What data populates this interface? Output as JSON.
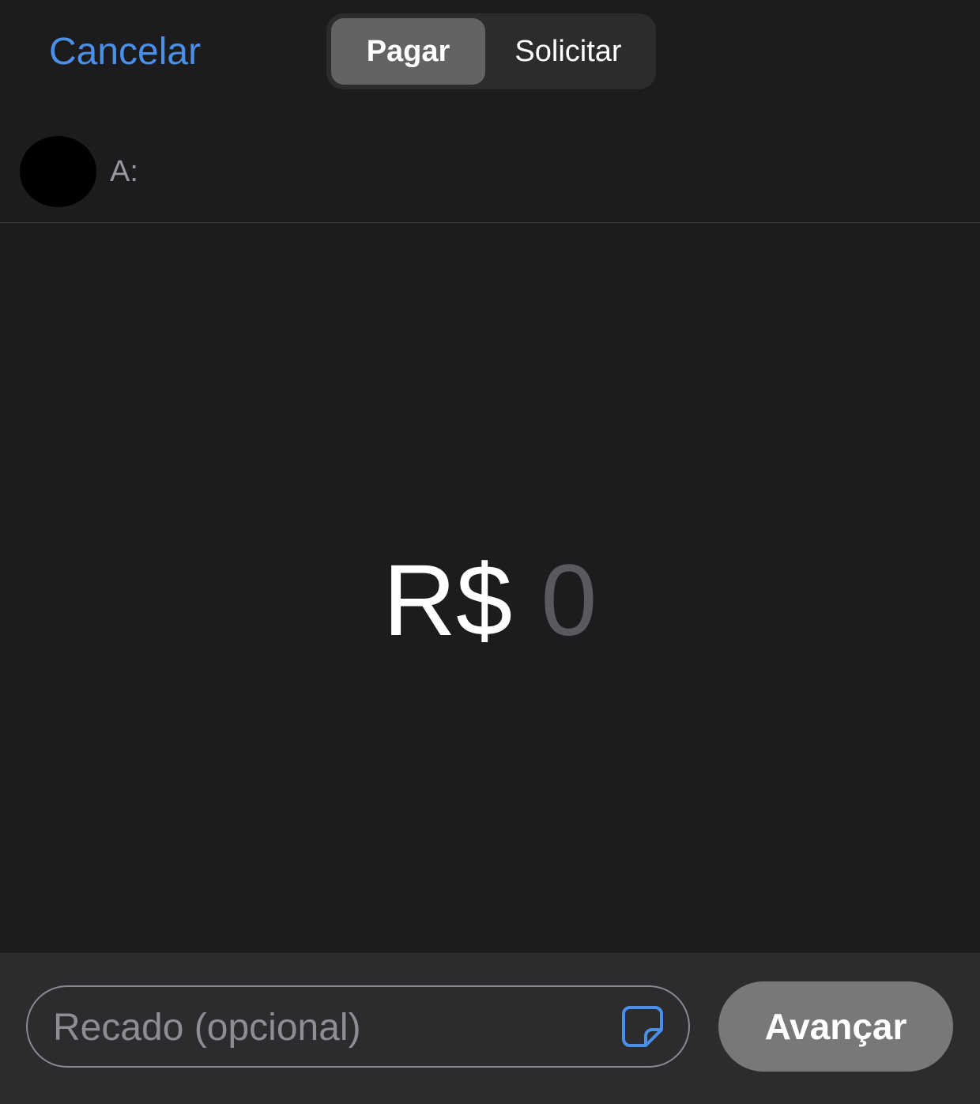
{
  "header": {
    "cancel_label": "Cancelar",
    "segments": [
      {
        "label": "Pagar",
        "selected": true
      },
      {
        "label": "Solicitar",
        "selected": false
      }
    ]
  },
  "recipient": {
    "to_label": "A:",
    "value": ""
  },
  "amount": {
    "currency": "R$",
    "value": "0"
  },
  "message": {
    "placeholder": "Recado (opcional)",
    "value": "",
    "sticker_icon": "sticker-icon"
  },
  "next_label": "Avançar",
  "colors": {
    "background": "#1c1c1e",
    "accent": "#4a90e8",
    "segment_bg": "#2c2c2e",
    "segment_selected": "#636366",
    "secondary_text": "#98989d",
    "amount_placeholder": "#5a5a5e",
    "divider": "#38383a",
    "bottom_bar": "#2c2c2e",
    "next_button": "#787878"
  }
}
